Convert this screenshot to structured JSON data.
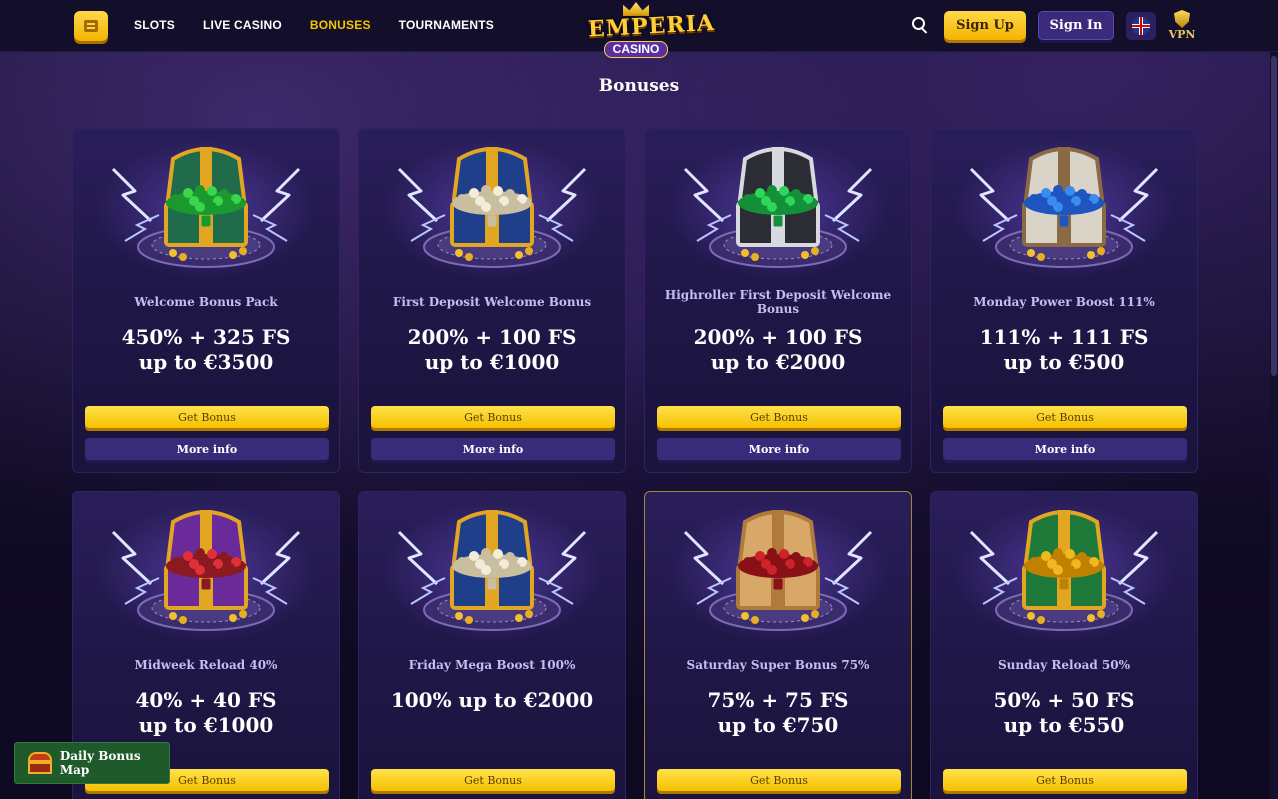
{
  "header": {
    "nav": [
      {
        "label": "SLOTS",
        "active": false
      },
      {
        "label": "LIVE CASINO",
        "active": false
      },
      {
        "label": "BONUSES",
        "active": true
      },
      {
        "label": "TOURNAMENTS",
        "active": false
      }
    ],
    "logo": {
      "line1": "EMPERIA",
      "line2": "CASINO"
    },
    "sign_up": "Sign Up",
    "sign_in": "Sign In",
    "vpn": "VPN",
    "icons": {
      "menu": "menu-icon",
      "search": "search-icon",
      "language": "uk-flag-icon",
      "vpn": "shield-icon"
    }
  },
  "page_title": "Bonuses",
  "cards": [
    {
      "name": "Welcome Bonus Pack",
      "offer_line1": "450% + 325 FS",
      "offer_line2": "up to €3500",
      "chest": "green-gold",
      "get_label": "Get Bonus",
      "more_label": "More info"
    },
    {
      "name": "First Deposit Welcome Bonus",
      "offer_line1": "200% + 100 FS",
      "offer_line2": "up to €1000",
      "chest": "blue-pearl",
      "get_label": "Get Bonus",
      "more_label": "More info"
    },
    {
      "name": "Highroller First Deposit Welcome Bonus",
      "offer_line1": "200% + 100 FS",
      "offer_line2": "up to €2000",
      "chest": "silver-emerald",
      "get_label": "Get Bonus",
      "more_label": "More info"
    },
    {
      "name": "Monday Power Boost 111%",
      "offer_line1": "111% + 111 FS",
      "offer_line2": "up to €500",
      "chest": "white-sapphire",
      "get_label": "Get Bonus",
      "more_label": "More info"
    },
    {
      "name": "Midweek Reload 40%",
      "offer_line1": "40% + 40 FS",
      "offer_line2": "up to €1000",
      "chest": "purple-ruby",
      "get_label": "Get Bonus"
    },
    {
      "name": "Friday Mega Boost 100%",
      "offer_line1": "100% up to €2000",
      "offer_line2": "",
      "chest": "blue-pearl",
      "get_label": "Get Bonus"
    },
    {
      "name": "Saturday Super Bonus 75%",
      "offer_line1": "75% + 75 FS",
      "offer_line2": "up to €750",
      "chest": "wood-ruby",
      "get_label": "Get Bonus",
      "highlighted": true
    },
    {
      "name": "Sunday Reload 50%",
      "offer_line1": "50% + 50 FS",
      "offer_line2": "up to €550",
      "chest": "green-gold-coins",
      "get_label": "Get Bonus"
    }
  ],
  "daily_map": {
    "label": "Daily Bonus Map",
    "icon": "treasure-chest-icon"
  },
  "colors": {
    "accent_yellow": "#f5c400",
    "card_bg": "#1e1645",
    "nav_active": "#f5c400",
    "daily_green": "#1f5a2a"
  }
}
